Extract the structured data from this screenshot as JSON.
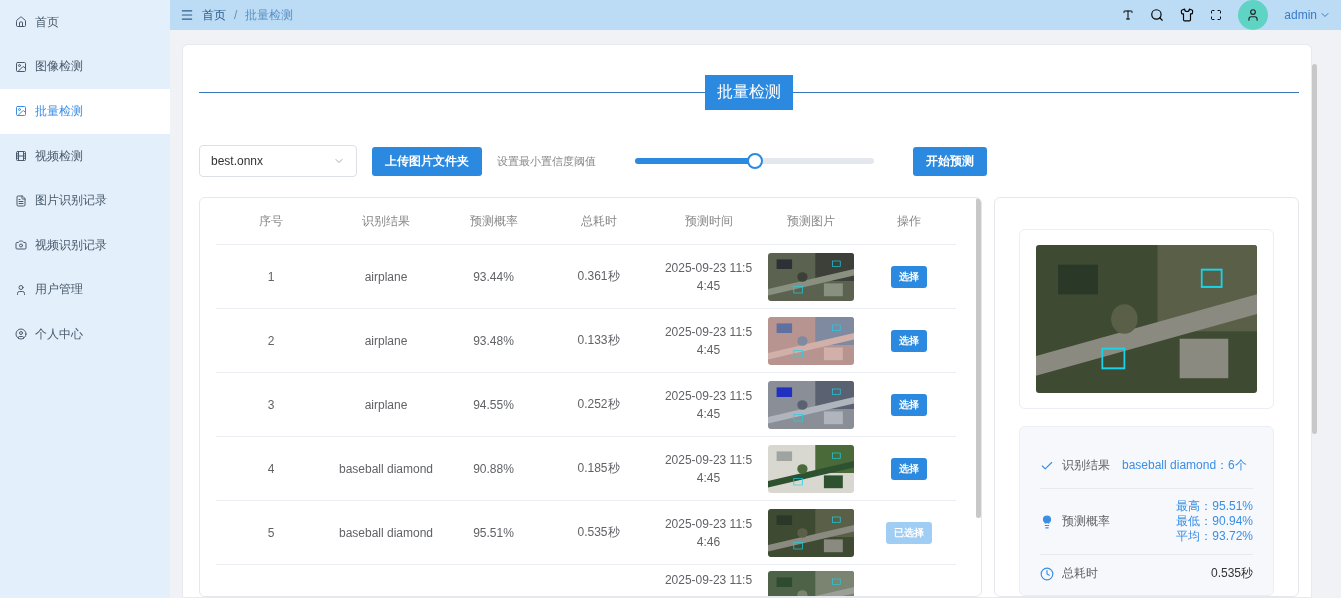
{
  "sidebar": {
    "items": [
      {
        "label": "首页",
        "selected": false
      },
      {
        "label": "图像检测",
        "selected": false
      },
      {
        "label": "批量检测",
        "selected": true
      },
      {
        "label": "视频检测",
        "selected": false
      },
      {
        "label": "图片识别记录",
        "selected": false
      },
      {
        "label": "视频识别记录",
        "selected": false
      },
      {
        "label": "用户管理",
        "selected": false
      },
      {
        "label": "个人中心",
        "selected": false
      }
    ]
  },
  "header": {
    "breadcrumb": [
      "首页",
      "批量检测"
    ],
    "breadcrumb_separator": "/",
    "user": "admin"
  },
  "page_title": "批量检测",
  "controls": {
    "model": "best.onnx",
    "upload_button": "上传图片文件夹",
    "threshold_label": "设置最小置信度阈值",
    "threshold": {
      "level": 0.5
    },
    "start_button": "开始预测"
  },
  "table": {
    "columns": [
      "序号",
      "识别结果",
      "预测概率",
      "总耗时",
      "预测时间",
      "预测图片",
      "操作"
    ],
    "rows": [
      {
        "index": "1",
        "result": "airplane",
        "probability": "93.44%",
        "duration": "0.361秒",
        "time": "2025-09-23 11:54:45",
        "action": "选择",
        "selected": false
      },
      {
        "index": "2",
        "result": "airplane",
        "probability": "93.48%",
        "duration": "0.133秒",
        "time": "2025-09-23 11:54:45",
        "action": "选择",
        "selected": false
      },
      {
        "index": "3",
        "result": "airplane",
        "probability": "94.55%",
        "duration": "0.252秒",
        "time": "2025-09-23 11:54:45",
        "action": "选择",
        "selected": false
      },
      {
        "index": "4",
        "result": "baseball diamond",
        "probability": "90.88%",
        "duration": "0.185秒",
        "time": "2025-09-23 11:54:45",
        "action": "选择",
        "selected": false
      },
      {
        "index": "5",
        "result": "baseball diamond",
        "probability": "95.51%",
        "duration": "0.535秒",
        "time": "2025-09-23 11:54:46",
        "action": "已选择",
        "selected": true
      },
      {
        "time": "2025-09-23 11:5"
      }
    ]
  },
  "detail": {
    "result_label": "识别结果",
    "result_value": "baseball diamond：6个",
    "probability_label": "预测概率",
    "probability_values": [
      "最高：95.51%",
      "最低：90.94%",
      "平均：93.72%"
    ],
    "duration_label": "总耗时",
    "duration_value": "0.535秒"
  }
}
